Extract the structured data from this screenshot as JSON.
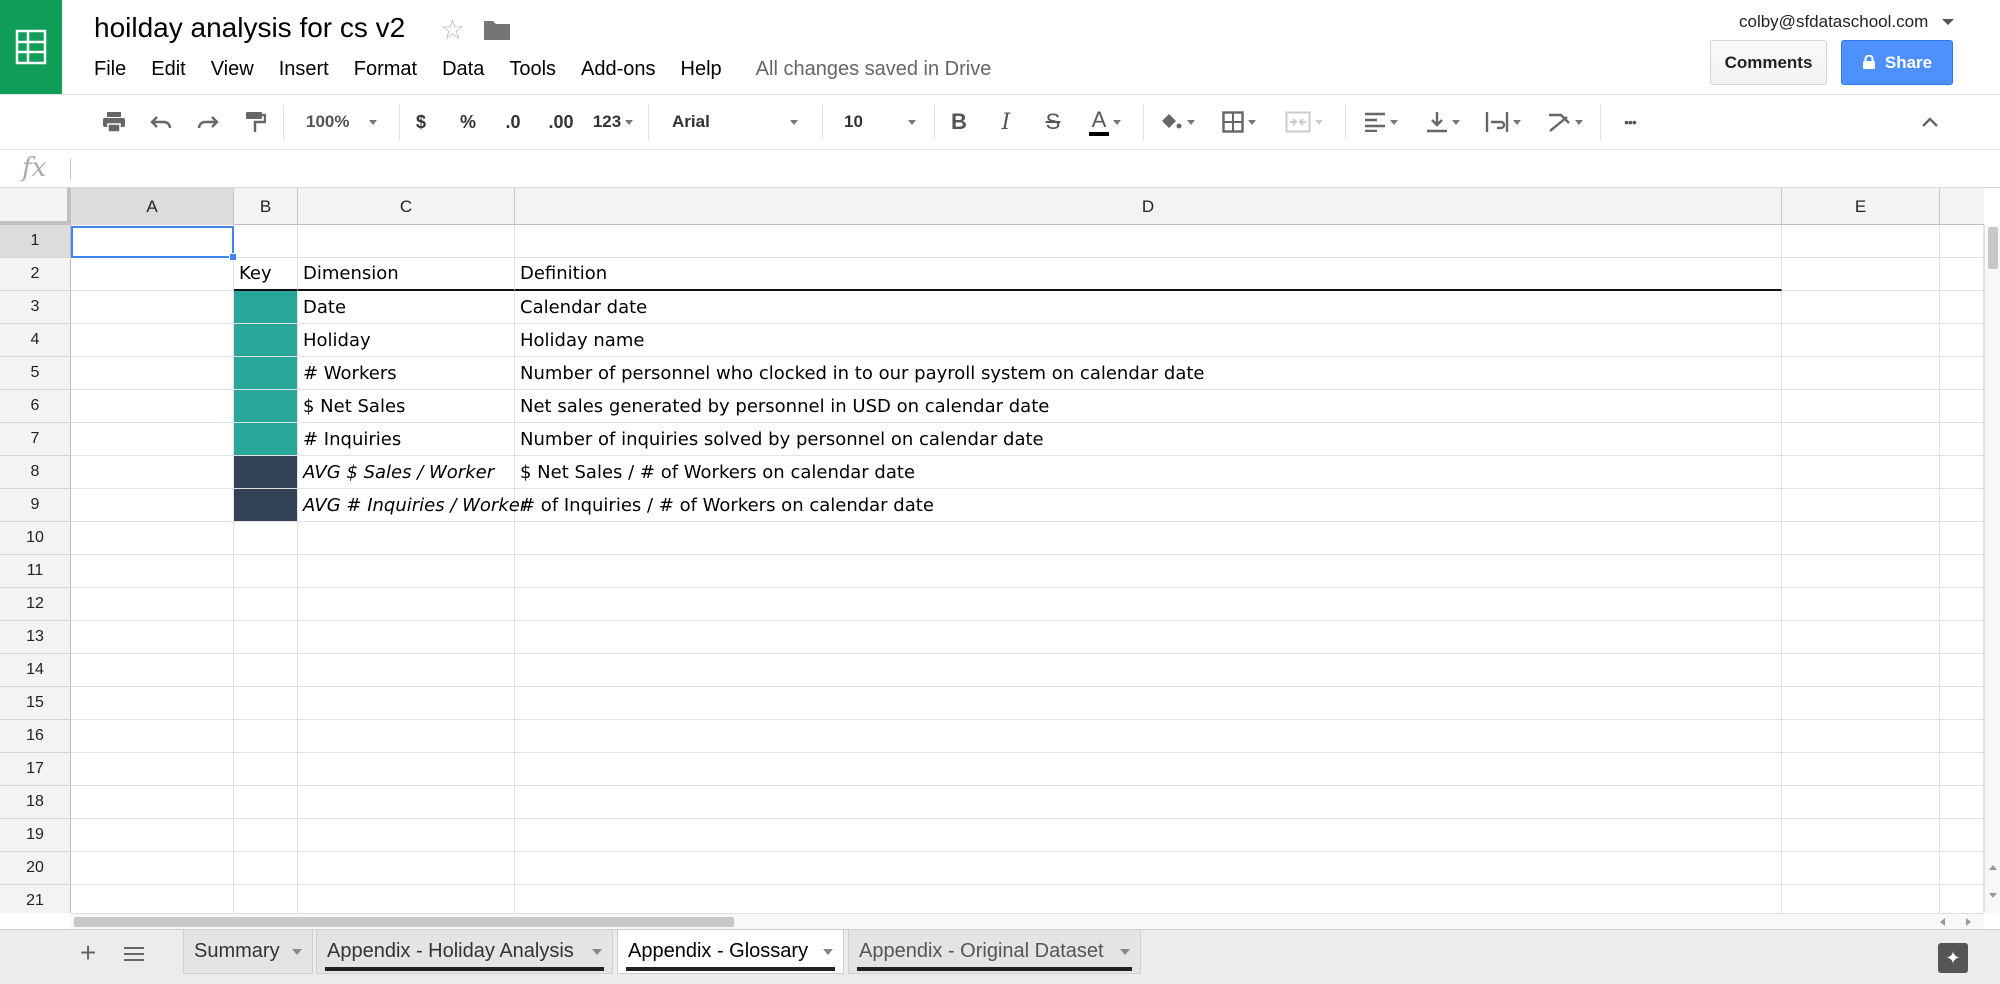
{
  "app": {
    "name": "Google Sheets"
  },
  "header": {
    "title": "hoilday analysis for cs v2",
    "menus": [
      "File",
      "Edit",
      "View",
      "Insert",
      "Format",
      "Data",
      "Tools",
      "Add-ons",
      "Help"
    ],
    "save_status": "All changes saved in Drive",
    "account_email": "colby@sfdataschool.com",
    "comments_label": "Comments",
    "share_label": "Share"
  },
  "toolbar": {
    "zoom": "100%",
    "currency": "$",
    "percent": "%",
    "decrease_decimal": ".0",
    "increase_decimal": ".00",
    "more_formats": "123",
    "font": "Arial",
    "font_size": "10",
    "bold": "B",
    "italic": "I",
    "strike": "S",
    "text_color": "A",
    "more": "•••"
  },
  "formula_bar": {
    "fx": "fx",
    "value": ""
  },
  "grid": {
    "columns": [
      "A",
      "B",
      "C",
      "D",
      "E"
    ],
    "selected_cell": "A1",
    "rows": [
      {
        "n": "1",
        "b": "",
        "c": "",
        "d": "",
        "swatch": ""
      },
      {
        "n": "2",
        "b": "Key",
        "c": "Dimension",
        "d": "Definition",
        "swatch": ""
      },
      {
        "n": "3",
        "b": "",
        "c": "Date",
        "d": "Calendar date",
        "swatch": "#2aa79b"
      },
      {
        "n": "4",
        "b": "",
        "c": "Holiday",
        "d": "Holiday name",
        "swatch": "#2aa79b"
      },
      {
        "n": "5",
        "b": "",
        "c": "# Workers",
        "d": "Number of personnel who clocked in to our payroll system on calendar date",
        "swatch": "#2aa79b"
      },
      {
        "n": "6",
        "b": "",
        "c": "$ Net Sales",
        "d": "Net sales generated by personnel in USD on calendar date",
        "swatch": "#2aa79b"
      },
      {
        "n": "7",
        "b": "",
        "c": "# Inquiries",
        "d": "Number of inquiries solved by personnel on calendar date",
        "swatch": "#2aa79b"
      },
      {
        "n": "8",
        "b": "",
        "c": "AVG $ Sales / Worker",
        "d": "$ Net Sales / # of Workers on calendar date",
        "swatch": "#344256",
        "italic": true
      },
      {
        "n": "9",
        "b": "",
        "c": "AVG # Inquiries / Worker",
        "d": "# of Inquiries / # of Workers on calendar date",
        "swatch": "#344256",
        "italic": true
      },
      {
        "n": "10",
        "b": "",
        "c": "",
        "d": "",
        "swatch": ""
      },
      {
        "n": "11",
        "b": "",
        "c": "",
        "d": "",
        "swatch": ""
      },
      {
        "n": "12",
        "b": "",
        "c": "",
        "d": "",
        "swatch": ""
      },
      {
        "n": "13",
        "b": "",
        "c": "",
        "d": "",
        "swatch": ""
      },
      {
        "n": "14",
        "b": "",
        "c": "",
        "d": "",
        "swatch": ""
      },
      {
        "n": "15",
        "b": "",
        "c": "",
        "d": "",
        "swatch": ""
      },
      {
        "n": "16",
        "b": "",
        "c": "",
        "d": "",
        "swatch": ""
      },
      {
        "n": "17",
        "b": "",
        "c": "",
        "d": "",
        "swatch": ""
      },
      {
        "n": "18",
        "b": "",
        "c": "",
        "d": "",
        "swatch": ""
      },
      {
        "n": "19",
        "b": "",
        "c": "",
        "d": "",
        "swatch": ""
      },
      {
        "n": "20",
        "b": "",
        "c": "",
        "d": "",
        "swatch": ""
      },
      {
        "n": "21",
        "b": "",
        "c": "",
        "d": "",
        "swatch": ""
      }
    ]
  },
  "sheets": {
    "add_label": "+",
    "tabs": [
      {
        "label": "Summary",
        "active": false,
        "underline": false
      },
      {
        "label": "Appendix - Holiday Analysis",
        "active": false,
        "underline": true
      },
      {
        "label": "Appendix - Glossary",
        "active": true,
        "underline": true
      },
      {
        "label": "Appendix - Original Dataset",
        "active": false,
        "underline": true
      }
    ]
  },
  "colors": {
    "brand_green": "#0f9d58",
    "share_blue": "#4d90fe",
    "key_teal": "#2aa79b",
    "key_navy": "#344256",
    "selection_blue": "#4285f4"
  },
  "icons": [
    "sheets-logo-icon",
    "star-icon",
    "folder-icon",
    "lock-icon",
    "print-icon",
    "undo-icon",
    "redo-icon",
    "paint-format-icon",
    "fill-color-icon",
    "borders-icon",
    "merge-cells-icon",
    "align-left-icon",
    "vertical-align-icon",
    "text-wrap-icon",
    "text-rotate-icon",
    "collapse-icon",
    "explore-icon",
    "sheet-list-icon"
  ]
}
